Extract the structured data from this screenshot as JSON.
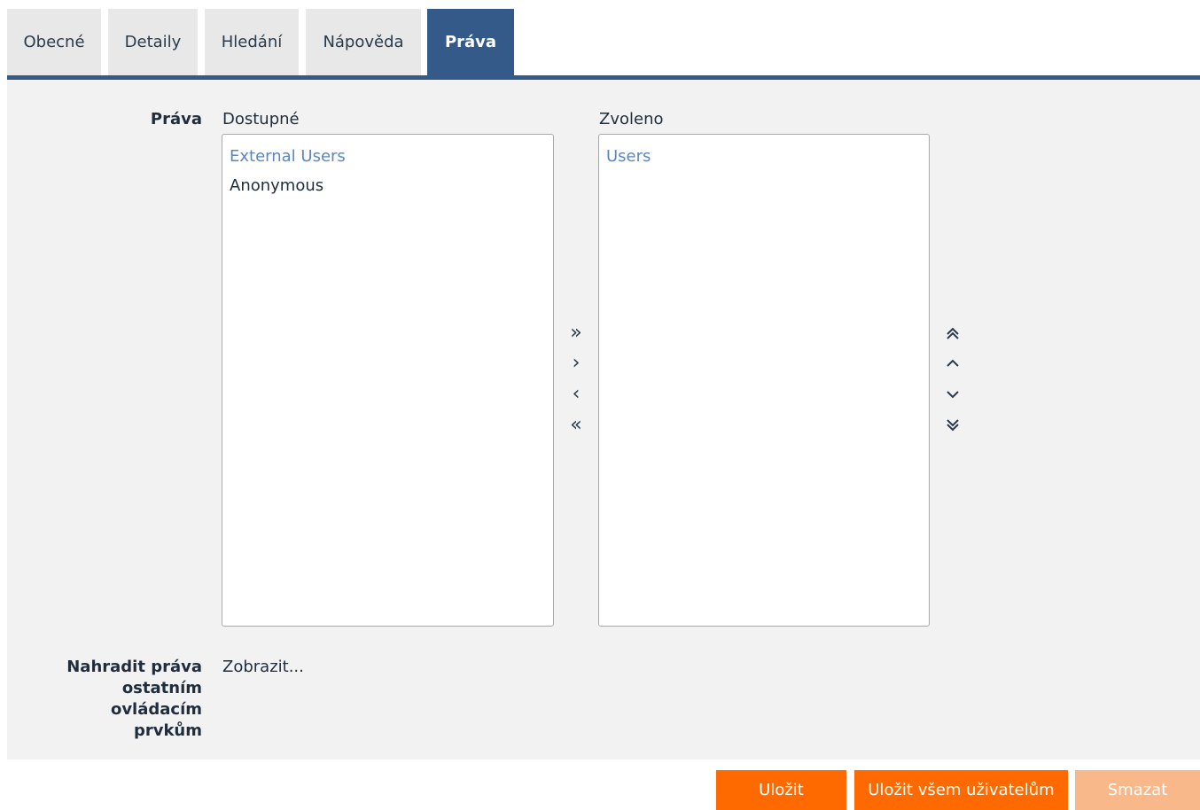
{
  "tabs": [
    {
      "label": "Obecné"
    },
    {
      "label": "Detaily"
    },
    {
      "label": "Hledání"
    },
    {
      "label": "Nápověda"
    },
    {
      "label": "Práva",
      "active": true
    }
  ],
  "rights": {
    "label": "Práva",
    "available_label": "Dostupné",
    "selected_label": "Zvoleno",
    "available_items": [
      {
        "text": "External Users",
        "selected": true
      },
      {
        "text": "Anonymous",
        "selected": false
      }
    ],
    "selected_items": [
      {
        "text": "Users",
        "selected": true
      }
    ],
    "transfer_icons": [
      "»",
      "›",
      "‹",
      "«"
    ],
    "order_icons": [
      "⌃⌃",
      "⌃",
      "⌄",
      "⌄⌄"
    ]
  },
  "replace": {
    "label_lines": [
      "Nahradit práva",
      "ostatním",
      "ovládacím",
      "prvkům"
    ],
    "link": "Zobrazit..."
  },
  "actions": {
    "save": "Uložit",
    "save_all": "Uložit všem uživatelům",
    "delete": "Smazat"
  },
  "colors": {
    "accent": "#345a8a",
    "primary_button": "#ff6a00",
    "disabled_button": "#f9b88a",
    "selected_item": "#5b86c0"
  }
}
